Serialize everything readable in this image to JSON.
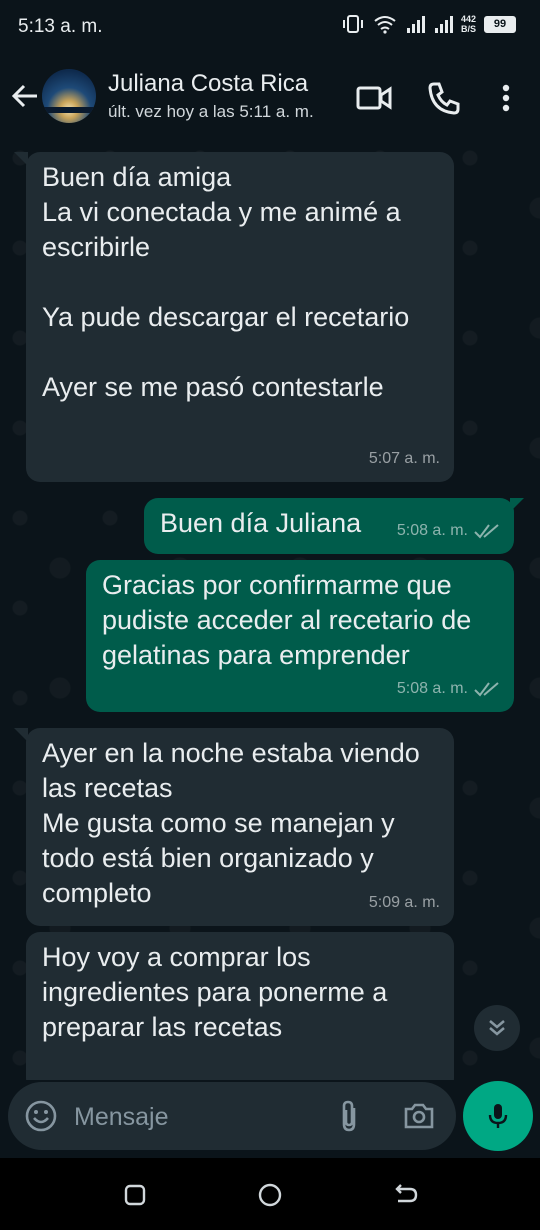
{
  "status_bar": {
    "time": "5:13 a. m.",
    "net_speed_value": "442",
    "net_speed_unit": "B/S",
    "battery": "99"
  },
  "header": {
    "contact_name": "Juliana Costa Rica",
    "last_seen": "últ. vez hoy a las 5:11 a. m.",
    "icons": [
      "back-arrow-icon",
      "video-call-icon",
      "phone-icon",
      "more-vert-icon"
    ]
  },
  "messages": [
    {
      "direction": "incoming",
      "text": "Buen día amiga\nLa vi conectada y me animé a escribirle\n\nYa pude descargar el recetario\n\nAyer se me pasó contestarle",
      "time": "5:07 a. m."
    },
    {
      "direction": "outgoing",
      "text": "Buen día Juliana",
      "time": "5:08 a. m.",
      "status": "read"
    },
    {
      "direction": "outgoing",
      "text": "Gracias por confirmarme que pudiste acceder al recetario de gelatinas para emprender",
      "time": "5:08 a. m.",
      "status": "read"
    },
    {
      "direction": "incoming",
      "text": "Ayer en la noche estaba viendo las recetas\nMe gusta como se manejan y todo está bien organizado y completo",
      "time": "5:09 a. m."
    },
    {
      "direction": "incoming",
      "text": "Hoy voy a comprar los ingredientes para ponerme a preparar las recetas",
      "time": ""
    }
  ],
  "input": {
    "placeholder": "Mensaje"
  },
  "colors": {
    "background": "#0b141a",
    "incoming_bubble": "#202c33",
    "outgoing_bubble": "#005c4b",
    "accent": "#00a884"
  }
}
